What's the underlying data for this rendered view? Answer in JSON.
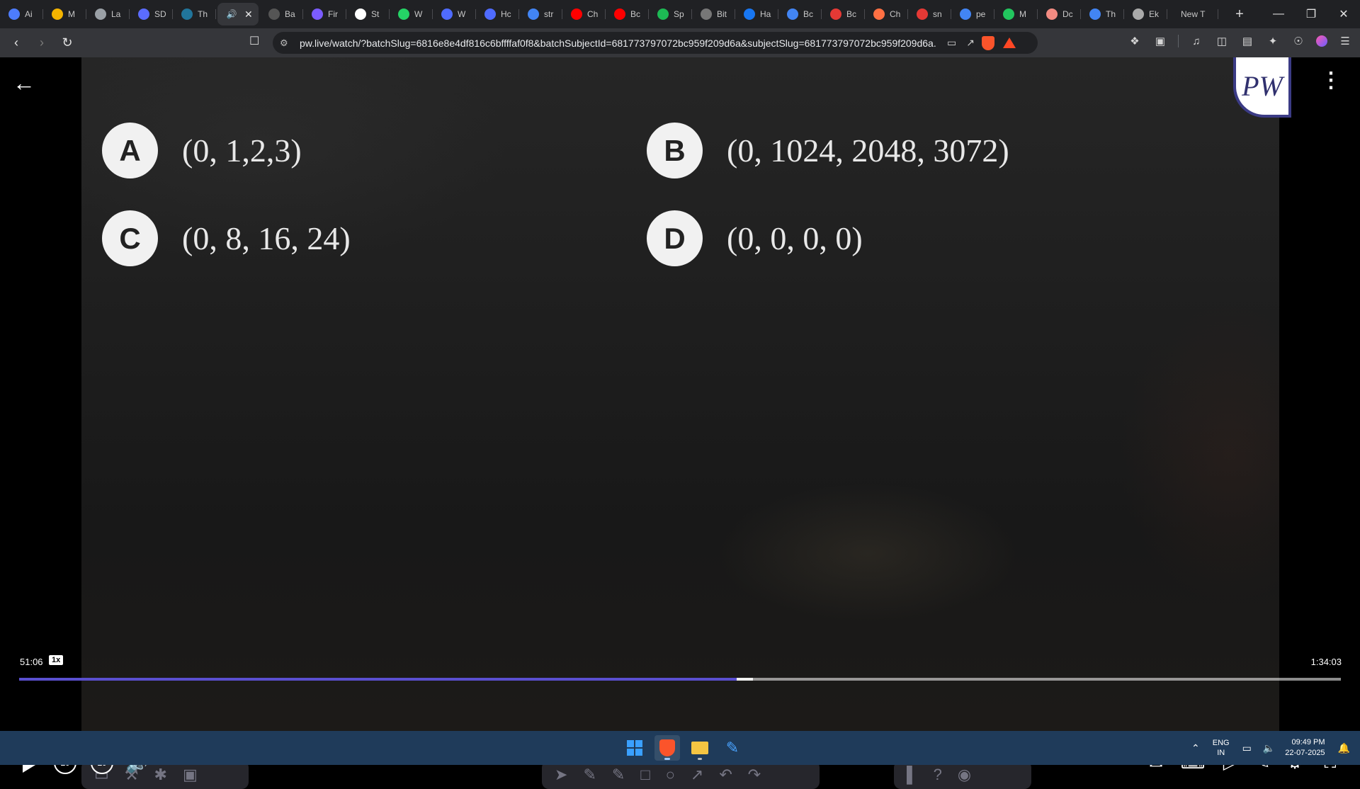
{
  "browser": {
    "tabs": [
      {
        "title": "Ai",
        "icon": "ai-chat-icon",
        "color": "#4d7cfe"
      },
      {
        "title": "M",
        "icon": "bolt-icon",
        "color": "#f4b400"
      },
      {
        "title": "La",
        "icon": "globe-icon",
        "color": "#9aa0a6"
      },
      {
        "title": "SD",
        "icon": "sd-icon",
        "color": "#5b6cff"
      },
      {
        "title": "Th",
        "icon": "wordpress-icon",
        "color": "#21759b"
      },
      {
        "title": "",
        "icon": "speaker-icon",
        "color": "#35363a",
        "active": true
      },
      {
        "title": "Ba",
        "icon": "batch-icon",
        "color": "#555"
      },
      {
        "title": "Fir",
        "icon": "fir-icon",
        "color": "#7b5cff"
      },
      {
        "title": "St",
        "icon": "openai-icon",
        "color": "#ffffff"
      },
      {
        "title": "W",
        "icon": "whatsapp-icon",
        "color": "#25d366"
      },
      {
        "title": "W",
        "icon": "shield-blue-icon",
        "color": "#4f6bff"
      },
      {
        "title": "Hc",
        "icon": "shield-blue-icon",
        "color": "#4f6bff"
      },
      {
        "title": "str",
        "icon": "google-icon",
        "color": "#4285f4"
      },
      {
        "title": "Ch",
        "icon": "youtube-icon",
        "color": "#ff0000"
      },
      {
        "title": "Bc",
        "icon": "youtube-icon",
        "color": "#ff0000"
      },
      {
        "title": "Sp",
        "icon": "spotify-icon",
        "color": "#1db954"
      },
      {
        "title": "Bit",
        "icon": "bit-icon",
        "color": "#777"
      },
      {
        "title": "Ha",
        "icon": "facebook-icon",
        "color": "#1877f2"
      },
      {
        "title": "Bc",
        "icon": "google-icon",
        "color": "#4285f4"
      },
      {
        "title": "Bc",
        "icon": "book-icon",
        "color": "#e53935"
      },
      {
        "title": "Ch",
        "icon": "flame-icon",
        "color": "#ff7043"
      },
      {
        "title": "sn",
        "icon": "d-icon",
        "color": "#e53935"
      },
      {
        "title": "pe",
        "icon": "google-icon",
        "color": "#4285f4"
      },
      {
        "title": "M",
        "icon": "ring-icon",
        "color": "#22c55e"
      },
      {
        "title": "Dc",
        "icon": "robot-icon",
        "color": "#f28b82"
      },
      {
        "title": "Th",
        "icon": "google-icon",
        "color": "#4285f4"
      },
      {
        "title": "Ek",
        "icon": "book-icon",
        "color": "#aaaaaa"
      },
      {
        "title": "New T",
        "icon": "",
        "color": "#202124",
        "newtab": true
      }
    ],
    "url": "pw.live/watch/?batchSlug=6816e8e4df816c6bffffaf0f8&batchSubjectId=681773797072bc959f209d6a&subjectSlug=681773797072bc959f209d6a..."
  },
  "player": {
    "logo_text": "PW",
    "options": [
      {
        "letter": "A",
        "text": "(0, 1,2,3)"
      },
      {
        "letter": "B",
        "text": "(0, 1024, 2048, 3072)"
      },
      {
        "letter": "C",
        "text": "(0, 8, 16, 24)"
      },
      {
        "letter": "D",
        "text": "(0, 0, 0, 0)"
      }
    ],
    "current_time": "51:06",
    "speed": "1x",
    "total_time": "1:34:03",
    "progress_fraction": 0.543,
    "buffer_fraction": 0.555,
    "rewind_label": "10",
    "forward_label": "10",
    "accent_color": "#5a4fcf"
  },
  "taskbar": {
    "lang_line1": "ENG",
    "lang_line2": "IN",
    "time": "09:49 PM",
    "date": "22-07-2025"
  }
}
